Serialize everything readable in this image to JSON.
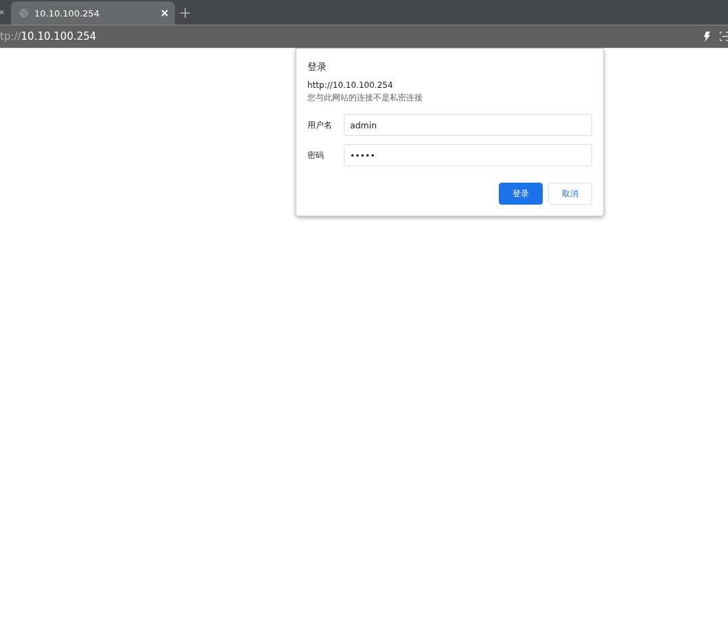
{
  "tabs": [
    {
      "title": "10.10.100.254",
      "selected": true
    }
  ],
  "address_bar": {
    "scheme_part": "tp://",
    "host": "10.10.100.254"
  },
  "dialog": {
    "title": "登录",
    "origin": "http://10.10.100.254",
    "warning": "您与此网站的连接不是私密连接",
    "fields": [
      {
        "label": "用户名",
        "value": "admin"
      },
      {
        "label": "密码",
        "value": "•••••"
      }
    ],
    "buttons": [
      {
        "label": "登录",
        "kind": "primary"
      },
      {
        "label": "取消",
        "kind": "secondary"
      }
    ]
  }
}
